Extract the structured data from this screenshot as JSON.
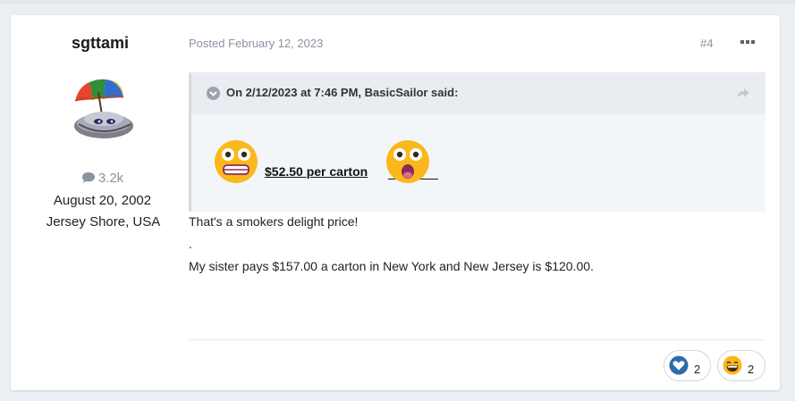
{
  "post": {
    "author": {
      "name": "sgttami",
      "post_count": "3.2k",
      "join_date": "August 20, 2002",
      "location": "Jersey Shore, USA"
    },
    "posted": "Posted February 12, 2023",
    "number": "#4",
    "quote": {
      "citation": "On 2/12/2023 at 7:46 PM, BasicSailor said:",
      "price_text": "$52.50 per carton"
    },
    "body": {
      "line1": "That's a smokers delight price!",
      "line2": ".",
      "line3": "My sister pays $157.00 a carton in New York and New Jersey is $120.00."
    },
    "reactions": [
      {
        "icon": "heart-icon",
        "count": "2"
      },
      {
        "icon": "laughing-face-icon",
        "count": "2"
      }
    ]
  },
  "colors": {
    "page_bg": "#ebeef2",
    "card_bg": "#ffffff",
    "meta_text": "#8a93a0",
    "quote_bg": "#f3f6f9",
    "emoji_yellow": "#fbb81c"
  }
}
